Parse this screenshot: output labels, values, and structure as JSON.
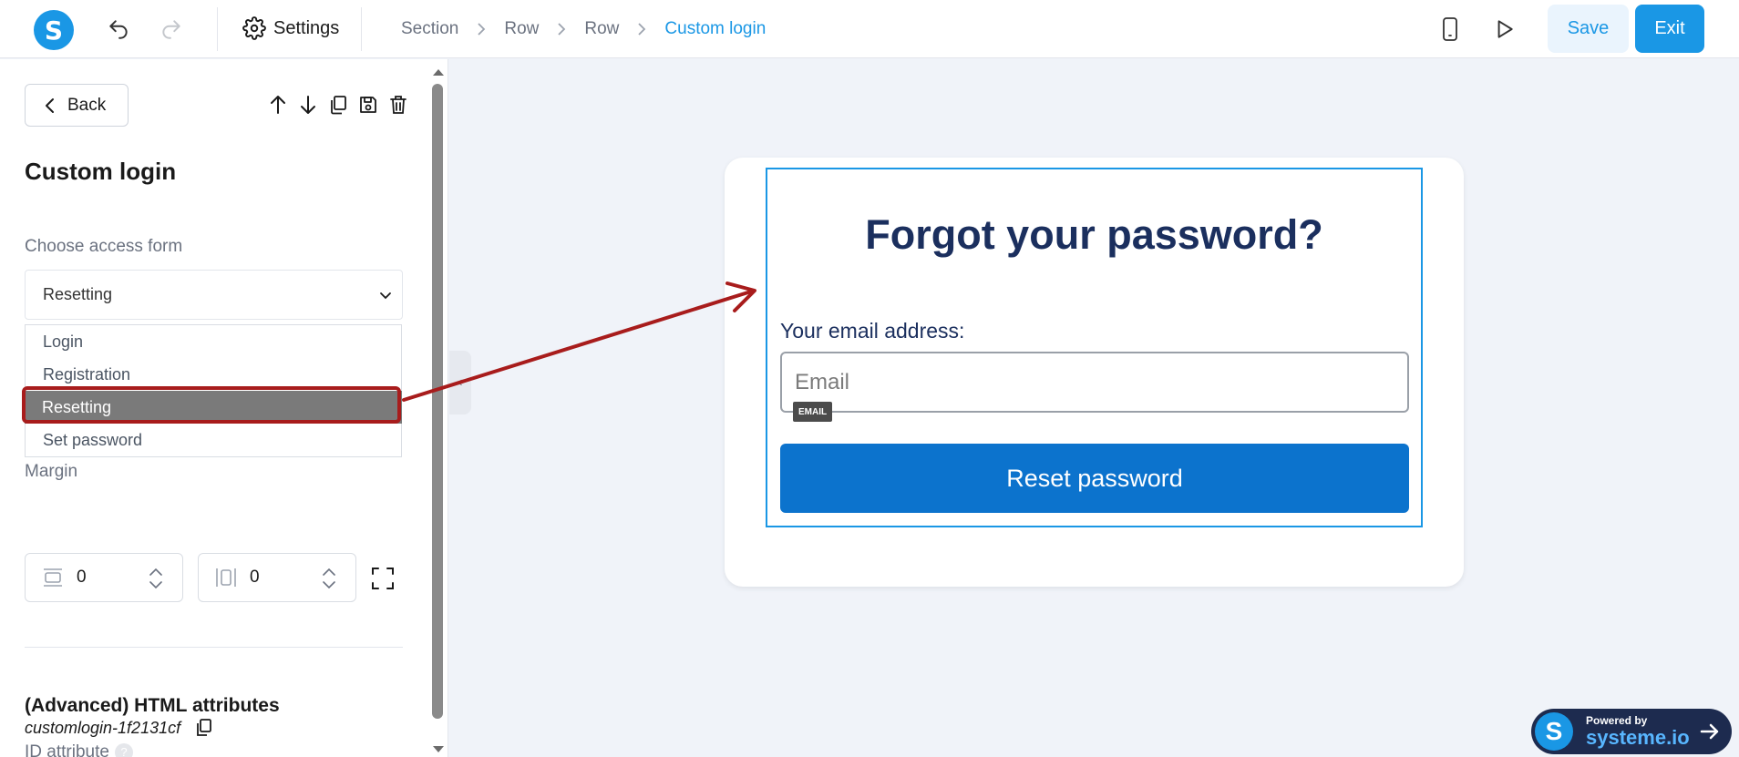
{
  "topbar": {
    "logo_letter": "S",
    "settings_label": "Settings",
    "breadcrumbs": [
      "Section",
      "Row",
      "Row",
      "Custom login"
    ],
    "save_label": "Save",
    "exit_label": "Exit",
    "accent": "#1a97e5"
  },
  "sidebar": {
    "back_label": "Back",
    "title": "Custom login",
    "access_form_label": "Choose access form",
    "access_form_value": "Resetting",
    "options": [
      "Login",
      "Registration",
      "Resetting",
      "Set password"
    ],
    "selected_option": "Resetting",
    "margin_label": "Margin",
    "margin_vertical": "0",
    "margin_horizontal": "0",
    "advanced_title": "(Advanced) HTML attributes",
    "id_label": "ID attribute",
    "id_help": "?",
    "id_value": "customlogin-1f2131cf"
  },
  "canvas": {
    "form_title": "Forgot your password?",
    "email_label": "Your email address:",
    "email_placeholder": "Email",
    "email_tag": "EMAIL",
    "button_label": "Reset password"
  },
  "badge": {
    "logo_letter": "S",
    "line1": "Powered by",
    "line2": "systeme.io"
  },
  "annotation_color": "#a81c1c"
}
